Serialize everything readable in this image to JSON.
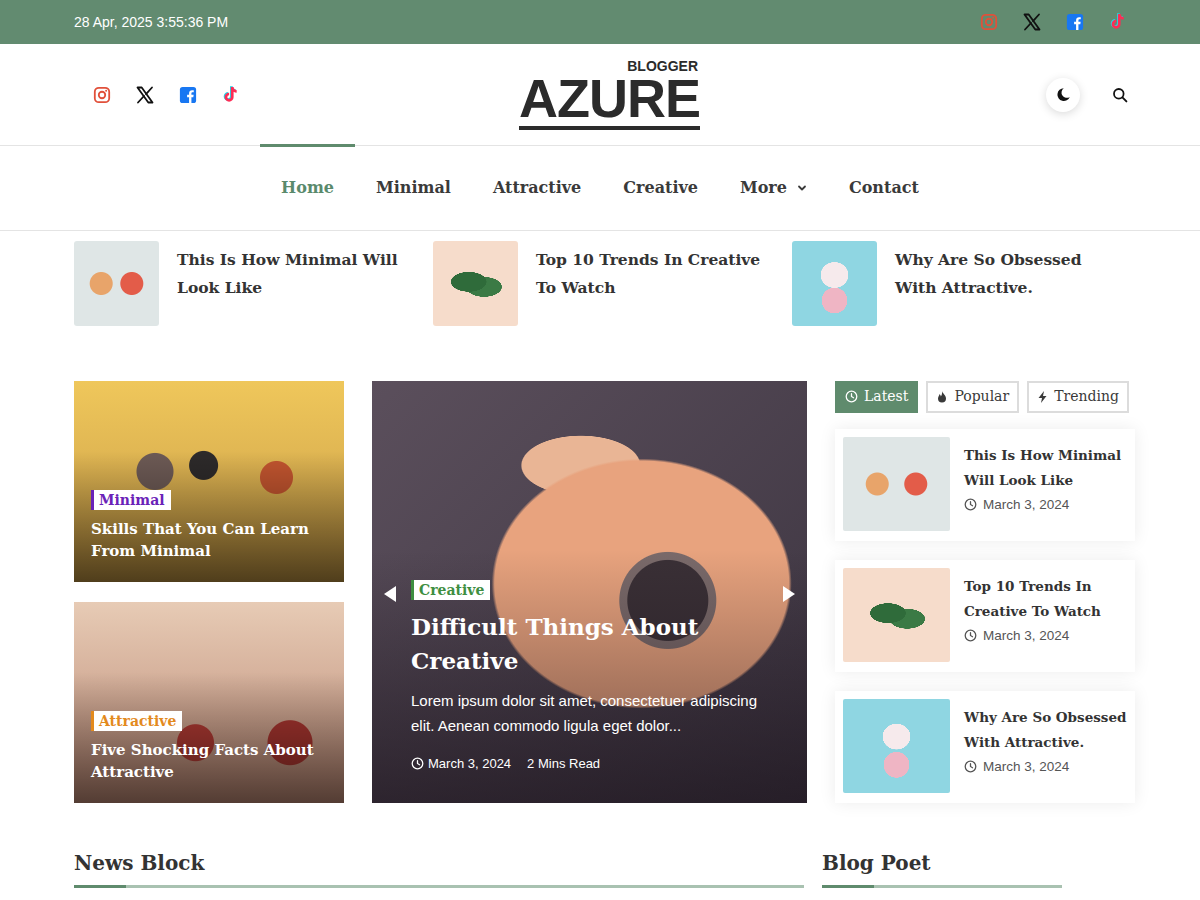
{
  "topbar": {
    "datetime": "28 Apr, 2025 3:55:36 PM"
  },
  "logo": {
    "tagline": "BLOGGER",
    "name": "AZURE"
  },
  "nav": [
    {
      "label": "Home",
      "selected": true,
      "kind": "link"
    },
    {
      "label": "Minimal",
      "selected": false,
      "kind": "link"
    },
    {
      "label": "Attractive",
      "selected": false,
      "kind": "link"
    },
    {
      "label": "Creative",
      "selected": false,
      "kind": "link"
    },
    {
      "label": "More",
      "selected": false,
      "kind": "dropdown"
    },
    {
      "label": "Contact",
      "selected": false,
      "kind": "link"
    }
  ],
  "ticker": [
    {
      "title": "This Is How Minimal Will Look Like"
    },
    {
      "title": "Top 10 Trends In Creative To Watch"
    },
    {
      "title": "Why Are So Obsessed With Attractive."
    }
  ],
  "side_posts": [
    {
      "category": "Minimal",
      "color": "#6a22b8",
      "title": "Skills That You Can Learn From Minimal"
    },
    {
      "category": "Attractive",
      "color": "#e38a1d",
      "title": "Five Shocking Facts About Attractive"
    }
  ],
  "featured": {
    "category": "Creative",
    "color": "#3e8e41",
    "title": "Difficult Things About Creative",
    "excerpt": "Lorem ipsum dolor sit amet, consectetuer adipiscing elit. Aenean commodo ligula eget dolor...",
    "date": "March 3, 2024",
    "read_time": "2 Mins Read"
  },
  "tabs": [
    {
      "label": "Latest",
      "selected": true
    },
    {
      "label": "Popular",
      "selected": false
    },
    {
      "label": "Trending",
      "selected": false
    }
  ],
  "latest": [
    {
      "title": "This Is How Minimal Will Look Like",
      "date": "March 3, 2024"
    },
    {
      "title": "Top 10 Trends In Creative To Watch",
      "date": "March 3, 2024"
    },
    {
      "title": "Why Are So Obsessed With Attractive.",
      "date": "March 3, 2024"
    }
  ],
  "sections": [
    {
      "title": "News Block"
    },
    {
      "title": "Blog Poet"
    }
  ]
}
